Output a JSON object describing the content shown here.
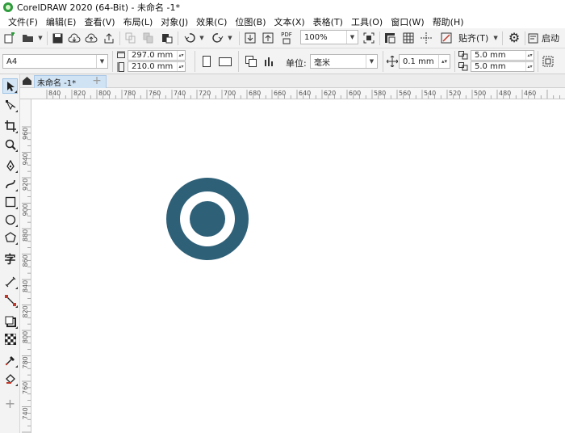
{
  "window": {
    "title": "CorelDRAW 2020 (64-Bit) - 未命名 -1*"
  },
  "menu": [
    "文件(F)",
    "编辑(E)",
    "查看(V)",
    "布局(L)",
    "对象(J)",
    "效果(C)",
    "位图(B)",
    "文本(X)",
    "表格(T)",
    "工具(O)",
    "窗口(W)",
    "帮助(H)"
  ],
  "toolbar": {
    "zoom_value": "100%",
    "pdf_label": "PDF",
    "snap_label": "贴齐(T)",
    "launch_label": "启动"
  },
  "property_bar": {
    "page_size": "A4",
    "width": "297.0 mm",
    "height": "210.0 mm",
    "unit_label": "单位:",
    "unit_value": "毫米",
    "nudge": "0.1 mm",
    "dup_x": "5.0 mm",
    "dup_y": "5.0 mm"
  },
  "tabs": {
    "doc_tab": "未命名 -1*",
    "add": "+"
  },
  "ruler_h": [
    "840",
    "820",
    "800",
    "780",
    "760",
    "740",
    "720",
    "700",
    "680",
    "660",
    "640",
    "620",
    "600",
    "580",
    "560",
    "540",
    "520",
    "500",
    "480",
    "460"
  ],
  "ruler_v": [
    "960",
    "940",
    "920",
    "900",
    "880",
    "860",
    "840",
    "820",
    "800",
    "780",
    "760",
    "740",
    "720"
  ],
  "shape": {
    "outer_color": "#2e6078",
    "inner_color": "#ffffff",
    "center_color": "#2e6078"
  },
  "colors": {
    "accent": "#cfe3f5",
    "toolbar_bg": "#f3f3f3"
  }
}
